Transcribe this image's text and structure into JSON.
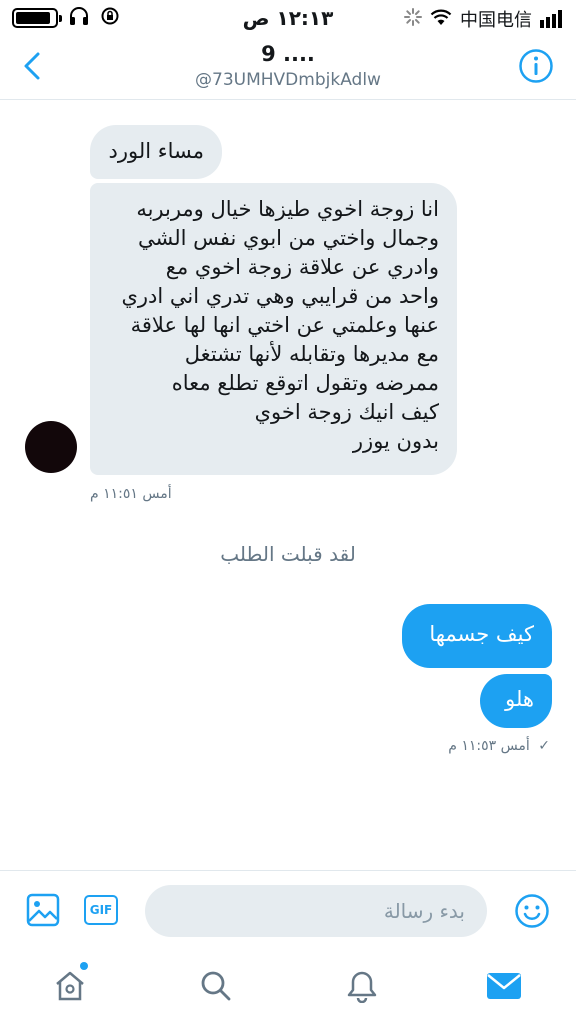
{
  "status_bar": {
    "time": "١٢:١٣ ص",
    "carrier": "中国电信",
    "battery_level": 0.9
  },
  "header": {
    "title": "9 ....",
    "handle": "@73UMHVDmbjkAdlw",
    "icons": {
      "back": "chevron-left-icon",
      "info": "info-icon"
    }
  },
  "messages": [
    {
      "direction": "in",
      "text": "مساء الورد"
    },
    {
      "direction": "in",
      "lines": [
        "انا زوجة اخوي طيزها خيال ومربربه",
        "وجمال واختي من ابوي نفس الشي",
        "وادري عن علاقة زوجة اخوي مع",
        "واحد من قرايبي وهي تدري اني ادري",
        "عنها وعلمتي عن اختي انها لها علاقة",
        "مع مديرها وتقابله لأنها تشتغل",
        "ممرضه وتقول اتوقع تطلع معاه",
        "كيف انيك زوجة اخوي",
        "بدون يوزر"
      ]
    },
    {
      "direction": "out",
      "text": "كيف جسمها"
    },
    {
      "direction": "out",
      "text": "هلو"
    }
  ],
  "incoming_timestamp": "أمس ١١:٥١ م",
  "outgoing_timestamp": "أمس ١١:٥٣ م",
  "system_notice": "لقد قبلت الطلب",
  "composer": {
    "placeholder": "بدء رسالة",
    "gif_label": "GIF"
  },
  "tabs": [
    {
      "name": "home",
      "icon": "home-icon",
      "badge": true
    },
    {
      "name": "search",
      "icon": "search-icon"
    },
    {
      "name": "notifications",
      "icon": "bell-icon"
    },
    {
      "name": "messages",
      "icon": "envelope-icon",
      "active": true
    }
  ],
  "colors": {
    "accent": "#1da1f2",
    "incoming_bubble": "#e6ecf0",
    "secondary_text": "#657786",
    "avatar": "#12070a"
  }
}
